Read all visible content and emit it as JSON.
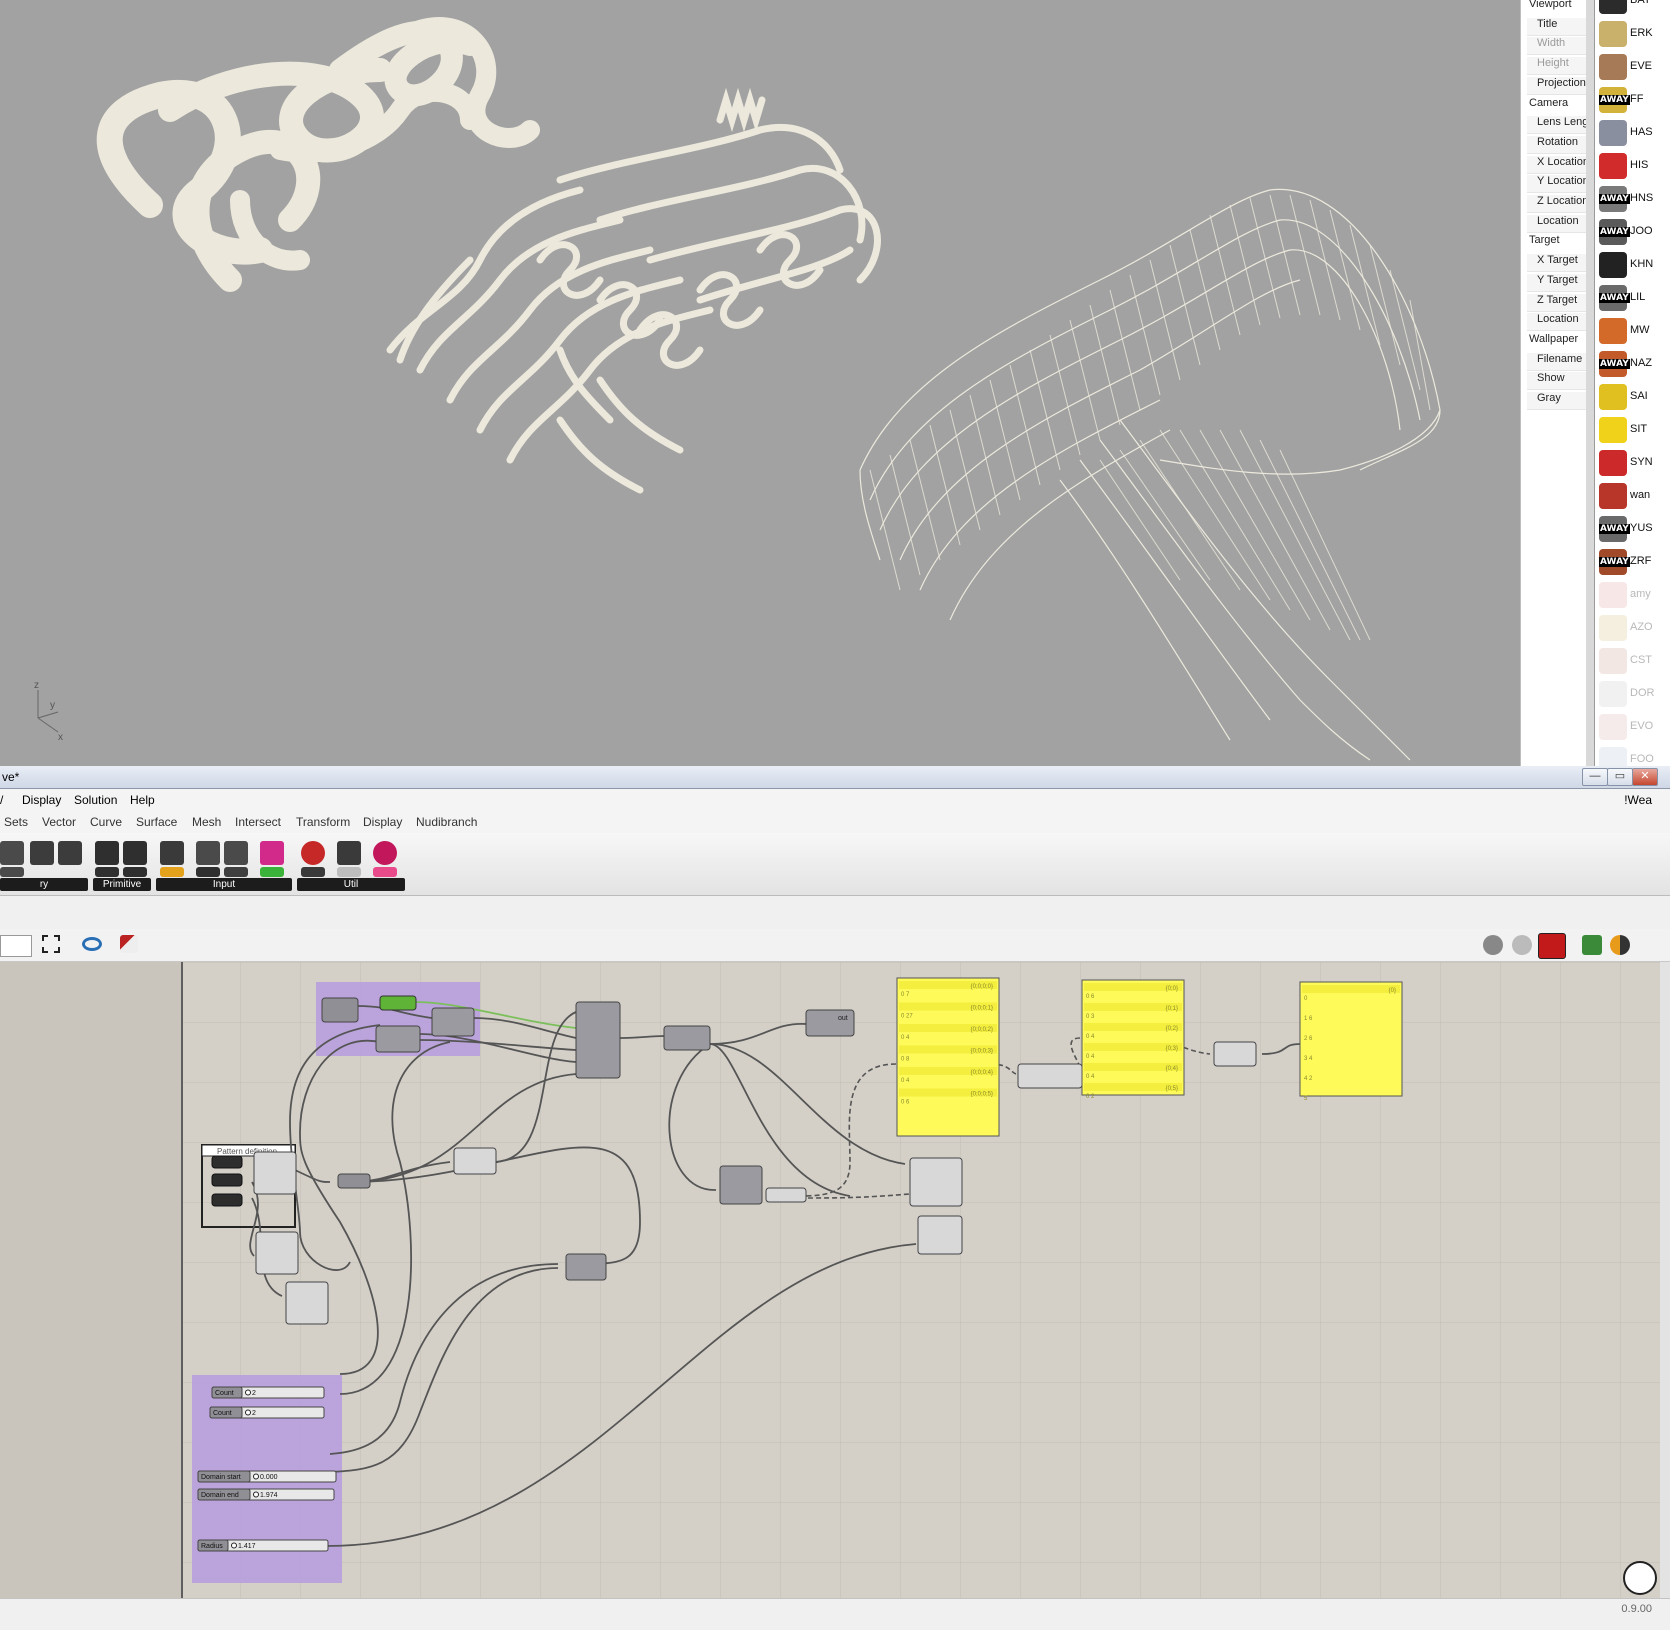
{
  "properties_panel": {
    "rows": [
      {
        "label": "Viewport",
        "kind": "section"
      },
      {
        "label": "Title",
        "kind": "item",
        "enabled": true
      },
      {
        "label": "Width",
        "kind": "item",
        "enabled": false
      },
      {
        "label": "Height",
        "kind": "item",
        "enabled": false
      },
      {
        "label": "Projection",
        "kind": "item",
        "enabled": true
      },
      {
        "label": "Camera",
        "kind": "section"
      },
      {
        "label": "Lens Length",
        "kind": "item",
        "enabled": true
      },
      {
        "label": "Rotation",
        "kind": "item",
        "enabled": true
      },
      {
        "label": "X Location",
        "kind": "item",
        "enabled": true
      },
      {
        "label": "Y Location",
        "kind": "item",
        "enabled": true
      },
      {
        "label": "Z Location",
        "kind": "item",
        "enabled": true
      },
      {
        "label": "Location",
        "kind": "item",
        "enabled": true
      },
      {
        "label": "Target",
        "kind": "section"
      },
      {
        "label": "X Target",
        "kind": "item",
        "enabled": true
      },
      {
        "label": "Y Target",
        "kind": "item",
        "enabled": true
      },
      {
        "label": "Z Target",
        "kind": "item",
        "enabled": true
      },
      {
        "label": "Location",
        "kind": "item",
        "enabled": true
      },
      {
        "label": "Wallpaper",
        "kind": "section"
      },
      {
        "label": "Filename",
        "kind": "item",
        "enabled": true
      },
      {
        "label": "Show",
        "kind": "item",
        "enabled": true
      },
      {
        "label": "Gray",
        "kind": "item",
        "enabled": true
      }
    ]
  },
  "buddies": [
    {
      "name": "BAT",
      "away": false,
      "online": true,
      "color": "#2b2b2b"
    },
    {
      "name": "ERK",
      "away": false,
      "online": true,
      "color": "#c9b16b"
    },
    {
      "name": "EVE",
      "away": false,
      "online": true,
      "color": "#a67a56"
    },
    {
      "name": "FF",
      "away": true,
      "online": true,
      "color": "#d3b23a"
    },
    {
      "name": "HAS",
      "away": false,
      "online": true,
      "color": "#8a8fa0"
    },
    {
      "name": "HIS",
      "away": false,
      "online": true,
      "color": "#d22b2b"
    },
    {
      "name": "HNS",
      "away": true,
      "online": true,
      "color": "#7a7a7a"
    },
    {
      "name": "JOO",
      "away": true,
      "online": true,
      "color": "#5a5a5a"
    },
    {
      "name": "KHN",
      "away": false,
      "online": true,
      "color": "#222222"
    },
    {
      "name": "LIL",
      "away": true,
      "online": true,
      "color": "#6a6a6a"
    },
    {
      "name": "MW",
      "away": false,
      "online": true,
      "color": "#d46a2a"
    },
    {
      "name": "NAZ",
      "away": true,
      "online": true,
      "color": "#c25a2a"
    },
    {
      "name": "SAI",
      "away": false,
      "online": true,
      "color": "#e0c020"
    },
    {
      "name": "SIT",
      "away": false,
      "online": true,
      "color": "#f1d21a"
    },
    {
      "name": "SYN",
      "away": false,
      "online": true,
      "color": "#cc2a2a"
    },
    {
      "name": "wan",
      "away": false,
      "online": true,
      "color": "#b8352a"
    },
    {
      "name": "YUS",
      "away": true,
      "online": true,
      "color": "#6a6a6a"
    },
    {
      "name": "ZRF",
      "away": true,
      "online": true,
      "color": "#a14a2a"
    },
    {
      "name": "amy",
      "away": false,
      "online": false,
      "color": "#e0a0a0"
    },
    {
      "name": "AZO",
      "away": false,
      "online": false,
      "color": "#d8c080"
    },
    {
      "name": "CST",
      "away": false,
      "online": false,
      "color": "#d0a090"
    },
    {
      "name": "DOR",
      "away": false,
      "online": false,
      "color": "#c8c8c8"
    },
    {
      "name": "EVO",
      "away": false,
      "online": false,
      "color": "#d8b0b0"
    },
    {
      "name": "FOO",
      "away": false,
      "online": false,
      "color": "#b8c8d8"
    }
  ],
  "gh_window": {
    "title": "ve*",
    "minimize": "—",
    "maximize": "▭",
    "close": "✕",
    "menus": [
      "Display",
      "Solution",
      "Help"
    ],
    "doc_name": "!Wea",
    "tabs": [
      "Sets",
      "Vector",
      "Curve",
      "Surface",
      "Mesh",
      "Intersect",
      "Transform",
      "Display",
      "Nudibranch"
    ],
    "ribbon_groups": [
      {
        "label": "ry"
      },
      {
        "label": "Primitive"
      },
      {
        "label": "Input"
      },
      {
        "label": "Util"
      }
    ],
    "version": "0.9.00"
  },
  "canvas": {
    "group_label": "Pattern definition",
    "sliders": [
      {
        "label": "Count",
        "value": "2"
      },
      {
        "label": "Count",
        "value": "2"
      },
      {
        "label": "Domain start",
        "value": "0.000"
      },
      {
        "label": "Domain end",
        "value": "1.974"
      },
      {
        "label": "Radius",
        "value": "1.417"
      }
    ],
    "panels": [
      {
        "rows": [
          "{0;0;0;0}",
          "{0;0;0;1}",
          "{0;0;0;2}",
          "{0;0;0;3}",
          "{0;0;0;4}",
          "{0;0;0;5}"
        ],
        "left": [
          "0 7",
          "0 27",
          "0 4",
          "0 8",
          "0 4",
          "0 6"
        ]
      },
      {
        "rows": [
          "{0;0}",
          "{0;1}",
          "{0;2}",
          "{0;3}",
          "{0;4}",
          "{0;5}"
        ],
        "left": [
          "0 6",
          "0 3",
          "0 4",
          "0 4",
          "0 4",
          "0 2"
        ]
      },
      {
        "rows": [
          "{0}"
        ],
        "left": [
          "0",
          "1 6",
          "2 6",
          "3 4",
          "4 2",
          "5"
        ]
      }
    ],
    "node_out_label": "out"
  },
  "viewport": {
    "axis_labels": [
      "z",
      "y",
      "x"
    ]
  }
}
